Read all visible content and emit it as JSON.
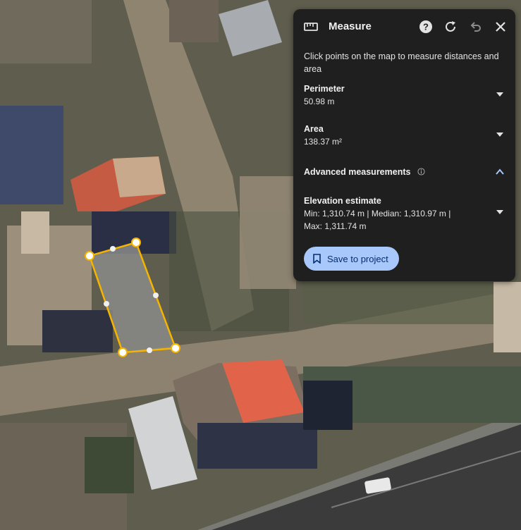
{
  "panel": {
    "title": "Measure",
    "instructions": "Click points on the map to measure distances and area",
    "perimeter": {
      "label": "Perimeter",
      "value": "50.98 m"
    },
    "area": {
      "label": "Area",
      "value": "138.37 m²"
    },
    "advanced": {
      "label": "Advanced measurements"
    },
    "elevation": {
      "label": "Elevation estimate",
      "line1": "Min: 1,310.74 m | Median: 1,310.97 m |",
      "line2": "Max: 1,311.74 m"
    },
    "save_label": "Save to project",
    "icons": [
      "ruler-icon",
      "help-icon",
      "refresh-icon",
      "undo-icon",
      "close-icon",
      "chevron-down-icon",
      "chevron-up-icon",
      "info-icon",
      "bookmark-icon"
    ]
  },
  "colors": {
    "panel_bg": "#1f1f1f",
    "accent_button": "#a8c7fa",
    "polygon_stroke": "#f5b400",
    "polygon_fill": "#8a8a8a"
  }
}
